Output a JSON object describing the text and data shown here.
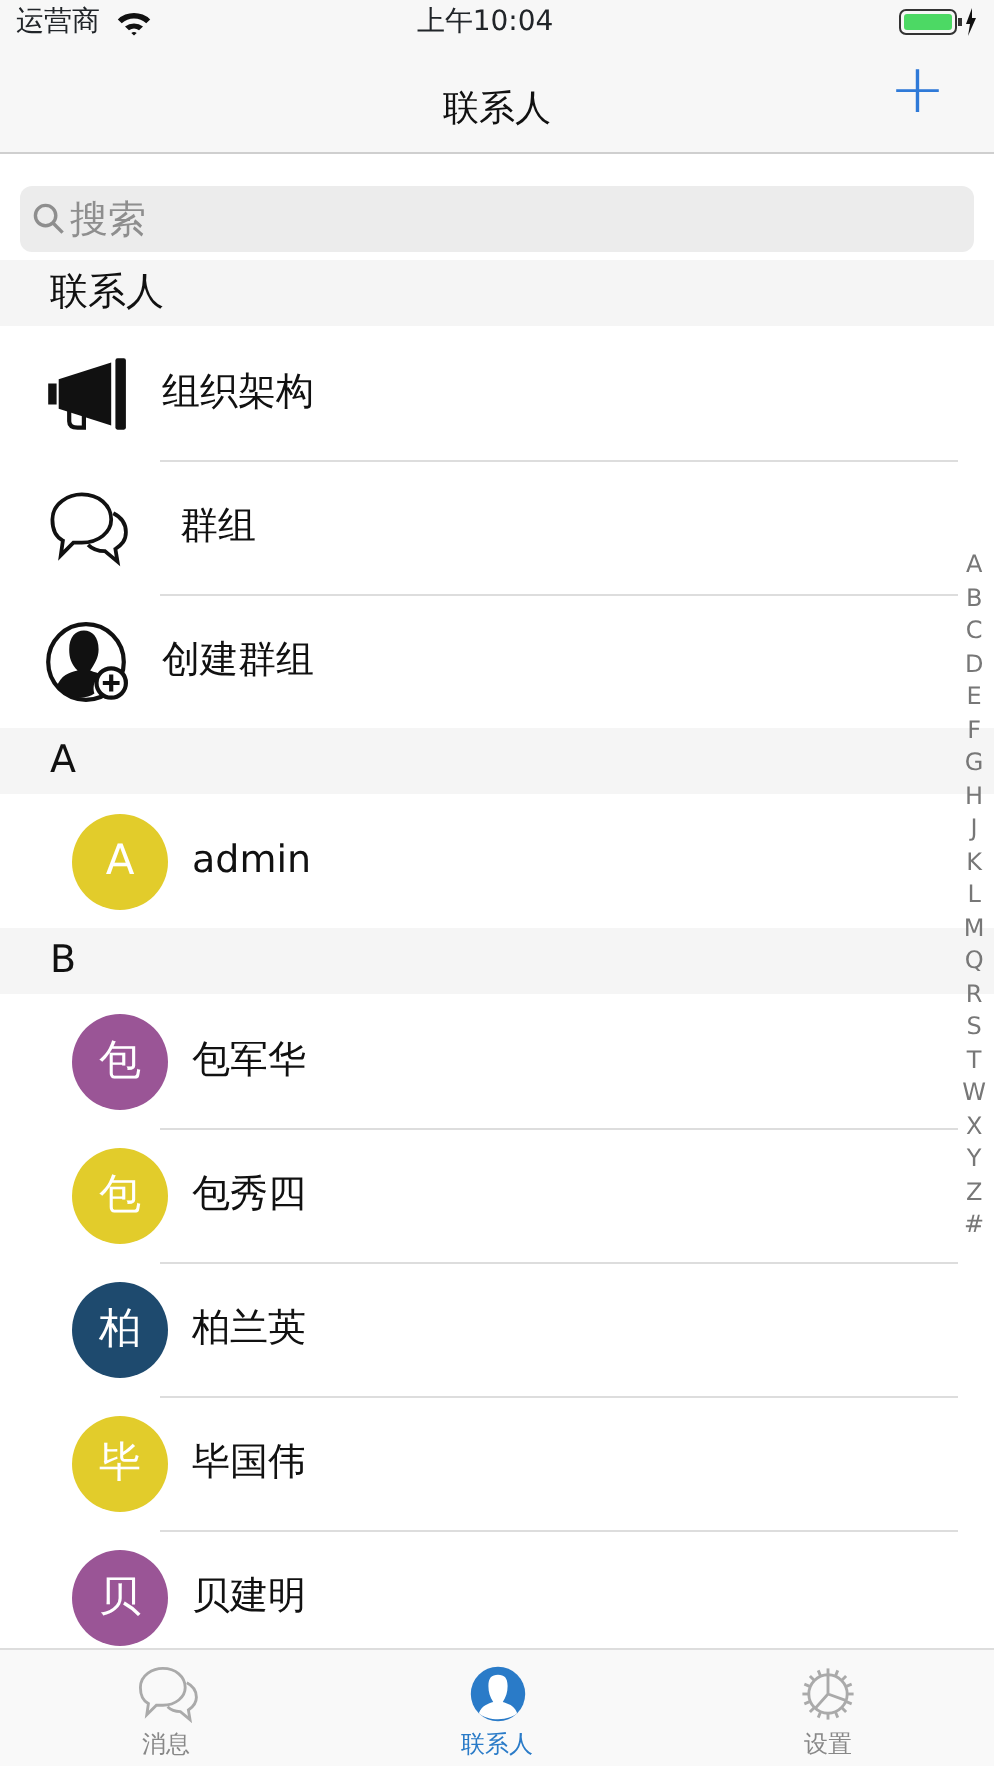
{
  "status_bar": {
    "carrier": "运营商",
    "time": "上午10:04"
  },
  "nav": {
    "title": "联系人",
    "add_button": "+"
  },
  "search": {
    "placeholder": "搜索"
  },
  "sections": [
    {
      "header": "联系人",
      "rows": [
        {
          "kind": "megaphone",
          "label": "组织架构"
        },
        {
          "kind": "chat",
          "label": "群组"
        },
        {
          "kind": "person-add",
          "label": "创建群组"
        }
      ]
    },
    {
      "header": "A",
      "rows": [
        {
          "kind": "contact",
          "avatar": "A",
          "label": "admin",
          "color": "#e2cc2b"
        }
      ]
    },
    {
      "header": "B",
      "rows": [
        {
          "kind": "contact",
          "avatar": "包",
          "label": "包军华",
          "color": "#9a5596"
        },
        {
          "kind": "contact",
          "avatar": "包",
          "label": "包秀四",
          "color": "#e2cc2b"
        },
        {
          "kind": "contact",
          "avatar": "柏",
          "label": "柏兰英",
          "color": "#1e4a6e"
        },
        {
          "kind": "contact",
          "avatar": "毕",
          "label": "毕国伟",
          "color": "#e2cc2b"
        },
        {
          "kind": "contact",
          "avatar": "贝",
          "label": "贝建明",
          "color": "#9a5596"
        }
      ]
    }
  ],
  "index_letters": [
    "A",
    "B",
    "C",
    "D",
    "E",
    "F",
    "G",
    "H",
    "J",
    "K",
    "L",
    "M",
    "Q",
    "R",
    "S",
    "T",
    "W",
    "X",
    "Y",
    "Z",
    "#"
  ],
  "tab_bar": [
    {
      "kind": "chat",
      "label": "消息",
      "selected": false
    },
    {
      "kind": "person",
      "label": "联系人",
      "selected": true
    },
    {
      "kind": "gear",
      "label": "设置",
      "selected": false
    }
  ]
}
